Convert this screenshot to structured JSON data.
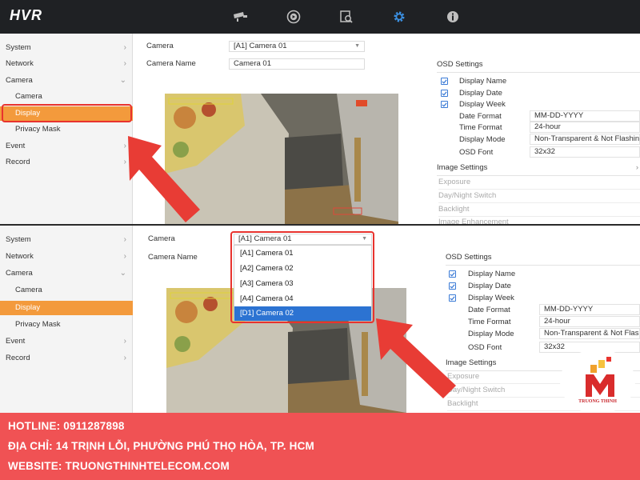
{
  "app": {
    "logo": "HVR"
  },
  "topbar": {
    "icons": [
      "camera-icon",
      "playback-icon",
      "search-icon",
      "settings-icon",
      "info-icon"
    ],
    "accent": "#3b8fe0"
  },
  "top_panel": {
    "sidebar": [
      {
        "label": "System",
        "chev": "›"
      },
      {
        "label": "Network",
        "chev": "›"
      },
      {
        "label": "Camera",
        "chev": "⌄"
      },
      {
        "label": "Camera",
        "chev": ""
      },
      {
        "label": "Display",
        "chev": ""
      },
      {
        "label": "Privacy Mask",
        "chev": ""
      },
      {
        "label": "Event",
        "chev": "›"
      },
      {
        "label": "Record",
        "chev": "›"
      }
    ],
    "camera_label": "Camera",
    "camera_value": "[A1] Camera 01",
    "camera_name_label": "Camera Name",
    "camera_name_value": "Camera 01",
    "osd_title": "OSD Settings",
    "checks": [
      "Display Name",
      "Display Date",
      "Display Week"
    ],
    "fields": [
      {
        "label": "Date Format",
        "value": "MM-DD-YYYY"
      },
      {
        "label": "Time Format",
        "value": "24-hour"
      },
      {
        "label": "Display Mode",
        "value": "Non-Transparent & Not Flashin"
      },
      {
        "label": "OSD Font",
        "value": "32x32"
      }
    ],
    "image_settings": "Image Settings",
    "image_items": [
      "Exposure",
      "Day/Night Switch",
      "Backlight",
      "Image Enhancement"
    ]
  },
  "bottom_panel": {
    "sidebar": [
      {
        "label": "System",
        "chev": "›"
      },
      {
        "label": "Network",
        "chev": "›"
      },
      {
        "label": "Camera",
        "chev": "⌄"
      },
      {
        "label": "Camera",
        "chev": ""
      },
      {
        "label": "Display",
        "chev": ""
      },
      {
        "label": "Privacy Mask",
        "chev": ""
      },
      {
        "label": "Event",
        "chev": "›"
      },
      {
        "label": "Record",
        "chev": "›"
      }
    ],
    "camera_label": "Camera",
    "camera_value": "[A1] Camera 01",
    "camera_name_label": "Camera Name",
    "dropdown_options": [
      "[A1] Camera 01",
      "[A2] Camera 02",
      "[A3] Camera 03",
      "[A4] Camera 04",
      "[D1] Camera 02"
    ],
    "selected_option": 4,
    "osd_title": "OSD Settings",
    "checks": [
      "Display Name",
      "Display Date",
      "Display Week"
    ],
    "fields": [
      {
        "label": "Date Format",
        "value": "MM-DD-YYYY"
      },
      {
        "label": "Time Format",
        "value": "24-hour"
      },
      {
        "label": "Display Mode",
        "value": "Non-Transparent & Not Flas"
      },
      {
        "label": "OSD Font",
        "value": "32x32"
      }
    ],
    "image_settings": "Image Settings",
    "image_items": [
      "Exposure",
      "Day/Night Switch",
      "Backlight"
    ]
  },
  "badge": {
    "brand": "TRUONG THINH"
  },
  "footer": {
    "hotline": "HOTLINE: 0911287898",
    "address": "ĐỊA CHỈ: 14 TRỊNH LỖI, PHƯỜNG PHÚ THỌ HÒA, TP. HCM",
    "website": "WEBSITE: TRUONGTHINHTELECOM.COM"
  },
  "colors": {
    "active_menu": "#f39a3c",
    "highlight_red": "#e8332e",
    "selected_option": "#2c73d2",
    "footer_bg": "#f05254"
  }
}
